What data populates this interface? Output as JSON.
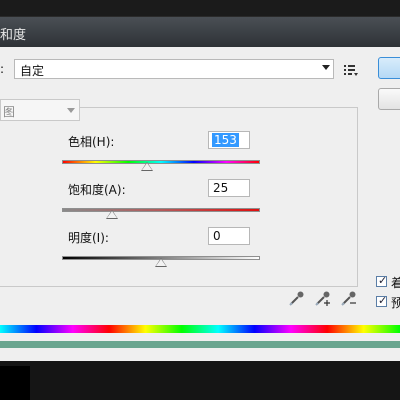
{
  "window": {
    "title": "和度"
  },
  "preset": {
    "label": ":",
    "value": "自定"
  },
  "channel": {
    "value": "图"
  },
  "hue": {
    "label": "色相(H):",
    "value": "153",
    "fraction": 0.43
  },
  "saturation": {
    "label": "饱和度(A):",
    "value": "25",
    "fraction": 0.25
  },
  "lightness": {
    "label": "明度(I):",
    "value": "0",
    "fraction": 0.5
  },
  "options": {
    "colorize_label": "着",
    "colorize_checked": true,
    "preview_label": "预",
    "preview_checked": true
  },
  "icons": {
    "preset_menu": "preset-options-icon",
    "eyedropper": "eyedropper-icon",
    "eyedropper_add": "eyedropper-plus-icon",
    "eyedropper_subtract": "eyedropper-minus-icon"
  },
  "colors": {
    "titlebar": "#3a3e43",
    "primary_button_border": "#3a8ed8",
    "selected_text_bg": "#3399ff",
    "spectrum_result": "#6aa58f"
  }
}
